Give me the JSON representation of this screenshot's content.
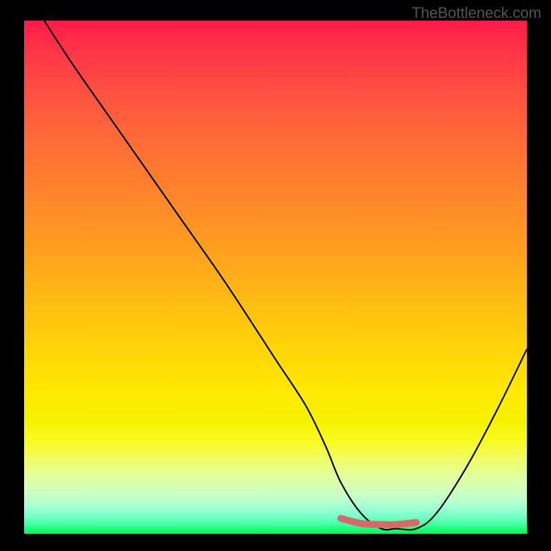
{
  "watermark": "TheBottleneck.com",
  "colors": {
    "page_bg": "#000000",
    "curve": "#000000",
    "marker": "#d46a6a",
    "watermark": "#555555"
  },
  "chart_data": {
    "type": "line",
    "title": "",
    "xlabel": "",
    "ylabel": "",
    "xlim": [
      0,
      100
    ],
    "ylim": [
      0,
      100
    ],
    "grid": false,
    "series": [
      {
        "name": "bottleneck_curve",
        "x": [
          4,
          10,
          20,
          30,
          40,
          50,
          56,
          60,
          63,
          67,
          71,
          74,
          78,
          82,
          88,
          94,
          100
        ],
        "values": [
          100,
          91,
          77,
          63,
          49,
          34,
          25,
          17,
          10,
          4,
          1,
          1,
          1,
          4,
          13,
          24,
          36
        ]
      }
    ],
    "highlight_segment": {
      "name": "optimal_range",
      "x": [
        63,
        67,
        71,
        74,
        78
      ],
      "values": [
        3.0,
        2.0,
        1.8,
        1.8,
        2.2
      ]
    }
  }
}
